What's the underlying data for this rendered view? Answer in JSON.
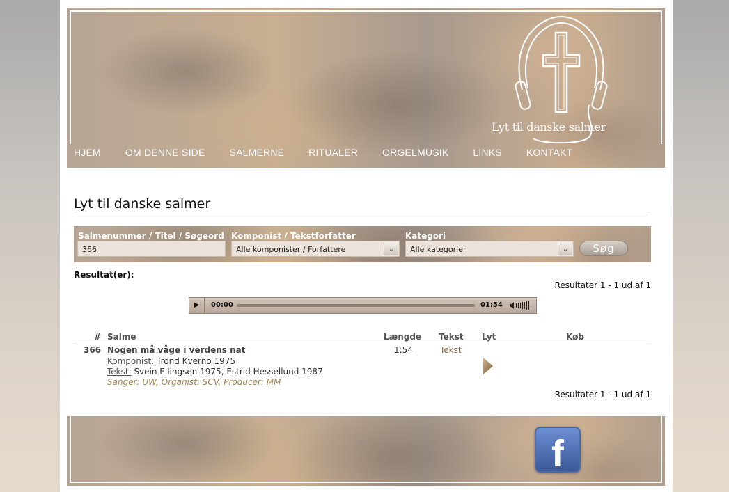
{
  "site": {
    "logo_text": "Lyt til danske salmer"
  },
  "nav": [
    "HJEM",
    "OM DENNE SIDE",
    "SALMERNE",
    "RITUALER",
    "ORGELMUSIK",
    "LINKS",
    "KONTAKT"
  ],
  "page_title": "Lyt til danske salmer",
  "search": {
    "query_label": "Salmenummer / Titel / Søgeord",
    "query_value": "366",
    "composer_label": "Komponist / Tekstforfatter",
    "composer_selected": "Alle komponister / Forfattere",
    "category_label": "Kategori",
    "category_selected": "Alle kategorier",
    "search_button": "Søg"
  },
  "results": {
    "label": "Resultat(er):",
    "count_text": "Resultater 1 - 1 ud af 1"
  },
  "player": {
    "current_time": "00:00",
    "duration": "01:54"
  },
  "table": {
    "headers": {
      "number": "#",
      "salme": "Salme",
      "length": "Længde",
      "text": "Tekst",
      "listen": "Lyt",
      "buy": "Køb"
    },
    "rows": [
      {
        "number": "366",
        "title": "Nogen må våge i verdens nat",
        "composer_label": "Komponist",
        "composer": ": Trond Kverno 1975",
        "text_label": "Tekst:",
        "text_authors": " Svein Ellingsen 1975, Estrid Hessellund 1987",
        "credits": "Sanger: UW, Organist: SCV, Producer: MM",
        "length": "1:54",
        "text_link": "Tekst"
      }
    ]
  },
  "footer": {
    "social_icon": "facebook-icon"
  }
}
